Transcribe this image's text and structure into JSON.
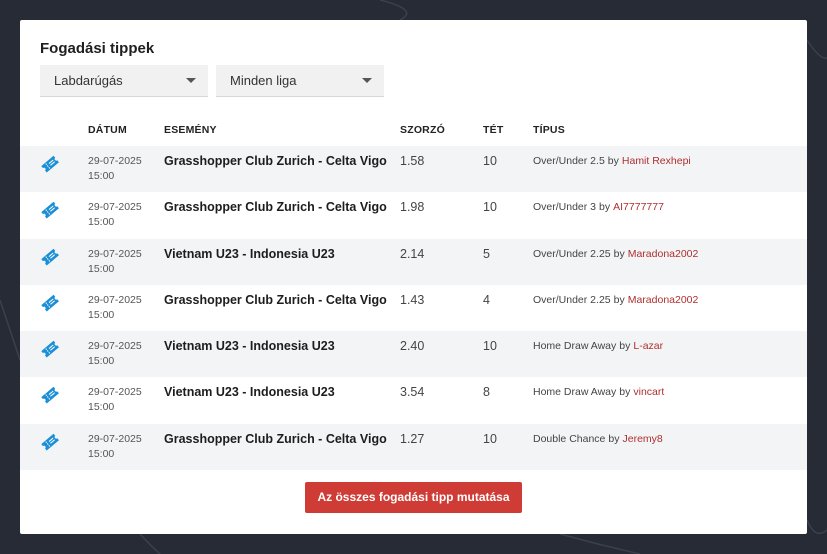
{
  "title": "Fogadási tippek",
  "filters": {
    "sport": "Labdarúgás",
    "league": "Minden liga"
  },
  "columns": {
    "date": "DÁTUM",
    "event": "ESEMÉNY",
    "odds": "SZORZÓ",
    "stake": "TÉT",
    "type": "TÍPUS"
  },
  "icon": "ticket-icon",
  "accent": "#cf3b35",
  "user_color": "#b02f2f",
  "tips": [
    {
      "date": "29-07-2025",
      "time": "15:00",
      "event": "Grasshopper Club Zurich - Celta Vigo",
      "odds": "1.58",
      "stake": "10",
      "type": "Over/Under 2.5",
      "by": "by",
      "user": "Hamit Rexhepi"
    },
    {
      "date": "29-07-2025",
      "time": "15:00",
      "event": "Grasshopper Club Zurich - Celta Vigo",
      "odds": "1.98",
      "stake": "10",
      "type": "Over/Under 3",
      "by": "by",
      "user": "AI7777777"
    },
    {
      "date": "29-07-2025",
      "time": "15:00",
      "event": "Vietnam U23 - Indonesia U23",
      "odds": "2.14",
      "stake": "5",
      "type": "Over/Under 2.25",
      "by": "by",
      "user": "Maradona2002"
    },
    {
      "date": "29-07-2025",
      "time": "15:00",
      "event": "Grasshopper Club Zurich - Celta Vigo",
      "odds": "1.43",
      "stake": "4",
      "type": "Over/Under 2.25",
      "by": "by",
      "user": "Maradona2002"
    },
    {
      "date": "29-07-2025",
      "time": "15:00",
      "event": "Vietnam U23 - Indonesia U23",
      "odds": "2.40",
      "stake": "10",
      "type": "Home Draw Away",
      "by": "by",
      "user": "L-azar"
    },
    {
      "date": "29-07-2025",
      "time": "15:00",
      "event": "Vietnam U23 - Indonesia U23",
      "odds": "3.54",
      "stake": "8",
      "type": "Home Draw Away",
      "by": "by",
      "user": "vincart"
    },
    {
      "date": "29-07-2025",
      "time": "15:00",
      "event": "Grasshopper Club Zurich - Celta Vigo",
      "odds": "1.27",
      "stake": "10",
      "type": "Double Chance",
      "by": "by",
      "user": "Jeremy8"
    }
  ],
  "show_all_button": "Az összes fogadási tipp mutatása"
}
